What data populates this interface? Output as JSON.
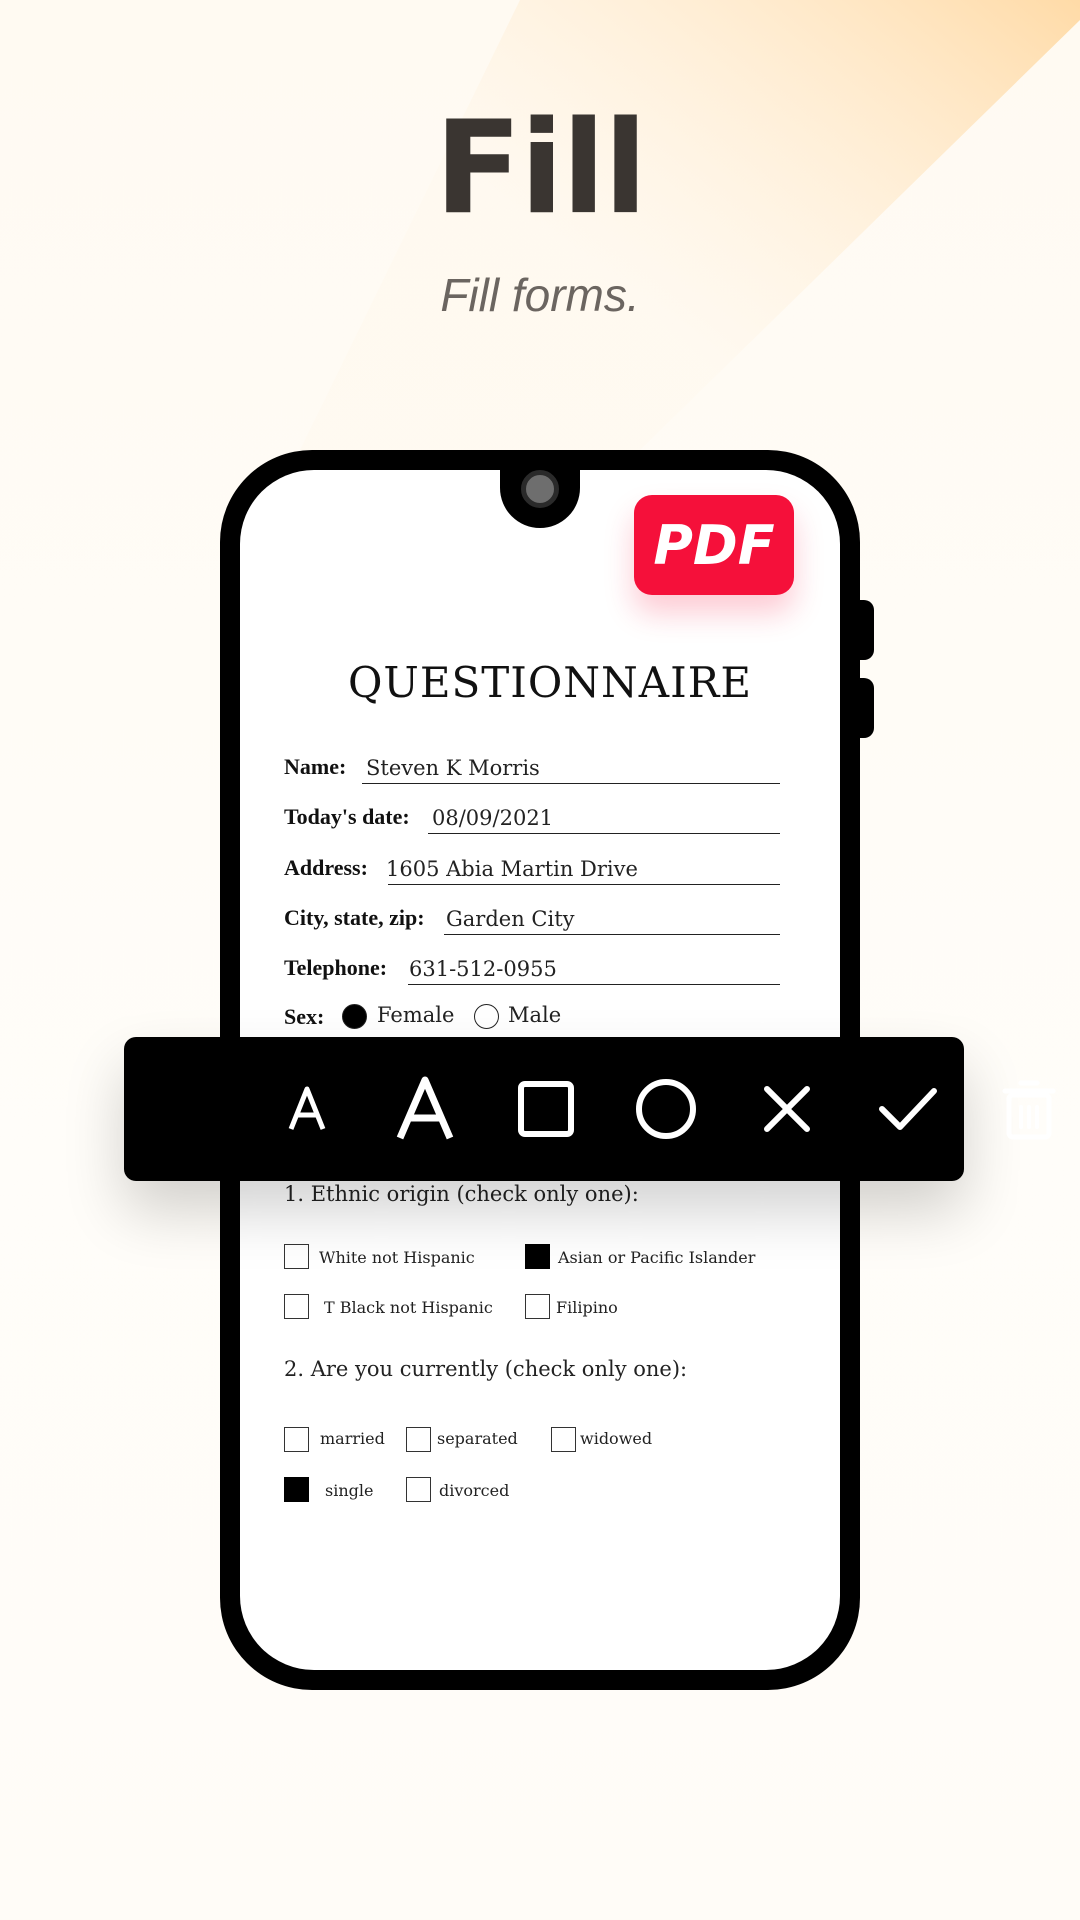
{
  "hero": {
    "title": "Fill",
    "subtitle": "Fill forms."
  },
  "badge": {
    "label": "PDF",
    "color": "#f5103a"
  },
  "form": {
    "title": "QUESTIONNAIRE",
    "fields": [
      {
        "label": "Name:",
        "value": "Steven K Morris"
      },
      {
        "label": "Today's date:",
        "value": "08/09/2021"
      },
      {
        "label": "Address:",
        "value": "1605 Abia Martin Drive"
      },
      {
        "label": "City, state, zip:",
        "value": "Garden City"
      },
      {
        "label": "Telephone:",
        "value": "631-512-0955"
      }
    ],
    "sex": {
      "label": "Sex:",
      "options": [
        {
          "label": "Female",
          "selected": true
        },
        {
          "label": "Male",
          "selected": false
        }
      ]
    },
    "q1": {
      "question": "1. Ethnic origin (check only one):",
      "options": [
        {
          "label": "White not Hispanic",
          "checked": false
        },
        {
          "label": "Asian or Pacific Islander",
          "checked": true
        },
        {
          "label": "T Black not Hispanic",
          "checked": false
        },
        {
          "label": "Filipino",
          "checked": false
        }
      ]
    },
    "q2": {
      "question": "2. Are you currently (check only one):",
      "options": [
        {
          "label": "married",
          "checked": false
        },
        {
          "label": "separated",
          "checked": false
        },
        {
          "label": "widowed",
          "checked": false
        },
        {
          "label": "single",
          "checked": true
        },
        {
          "label": "divorced",
          "checked": false
        }
      ]
    }
  },
  "toolbar": {
    "tools": [
      {
        "icon": "small-text-icon",
        "glyph": "A"
      },
      {
        "icon": "large-text-icon",
        "glyph": "A"
      },
      {
        "icon": "square-icon"
      },
      {
        "icon": "circle-icon"
      },
      {
        "icon": "cross-icon"
      },
      {
        "icon": "check-icon"
      },
      {
        "icon": "trash-icon"
      }
    ]
  }
}
